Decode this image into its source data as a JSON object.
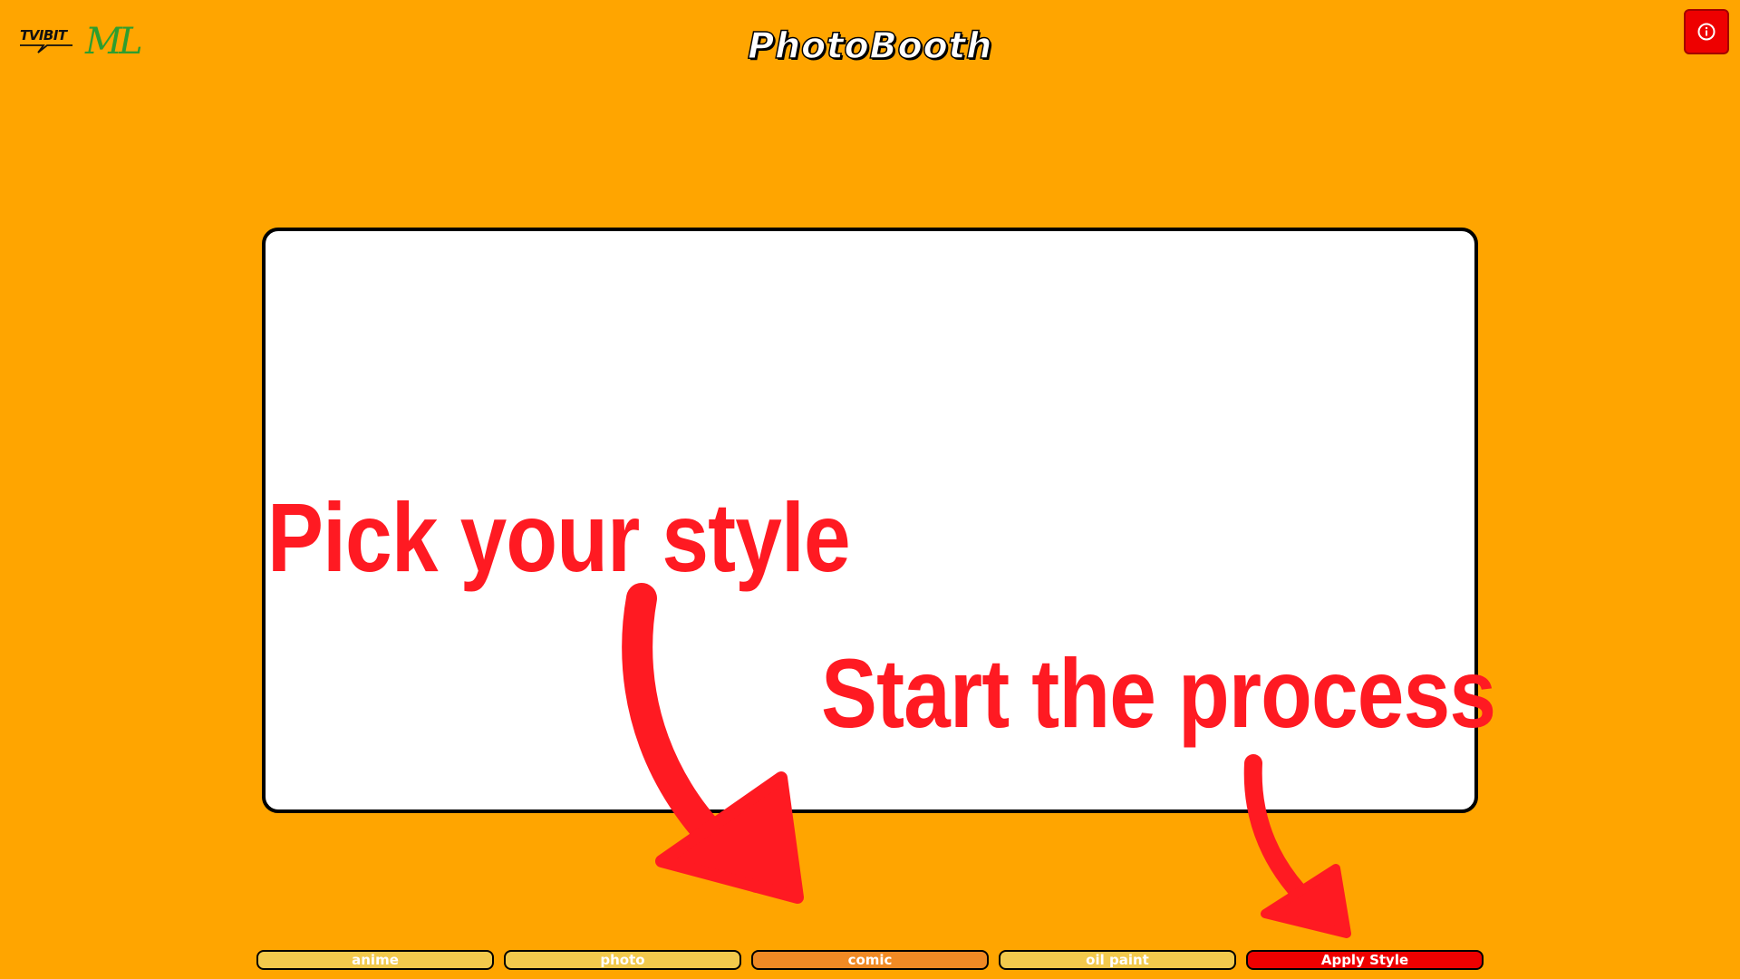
{
  "header": {
    "title": "PhotoBooth",
    "logo_left_text": "TVIBIT",
    "logo_right_text": "ML",
    "info_button_icon": "info-icon"
  },
  "overlay": {
    "pick_text": "Pick your style",
    "start_text": "Start the process"
  },
  "styles": {
    "buttons": [
      {
        "label": "anime",
        "state": "default"
      },
      {
        "label": "photo",
        "state": "default"
      },
      {
        "label": "comic",
        "state": "selected"
      },
      {
        "label": "oil paint",
        "state": "default"
      }
    ],
    "apply_label": "Apply Style"
  },
  "colors": {
    "background": "#FFA500",
    "accent_red": "#EE0000",
    "button_default": "#F2C94C",
    "button_selected": "#F08A24",
    "overlay_text": "#FF1A22"
  }
}
